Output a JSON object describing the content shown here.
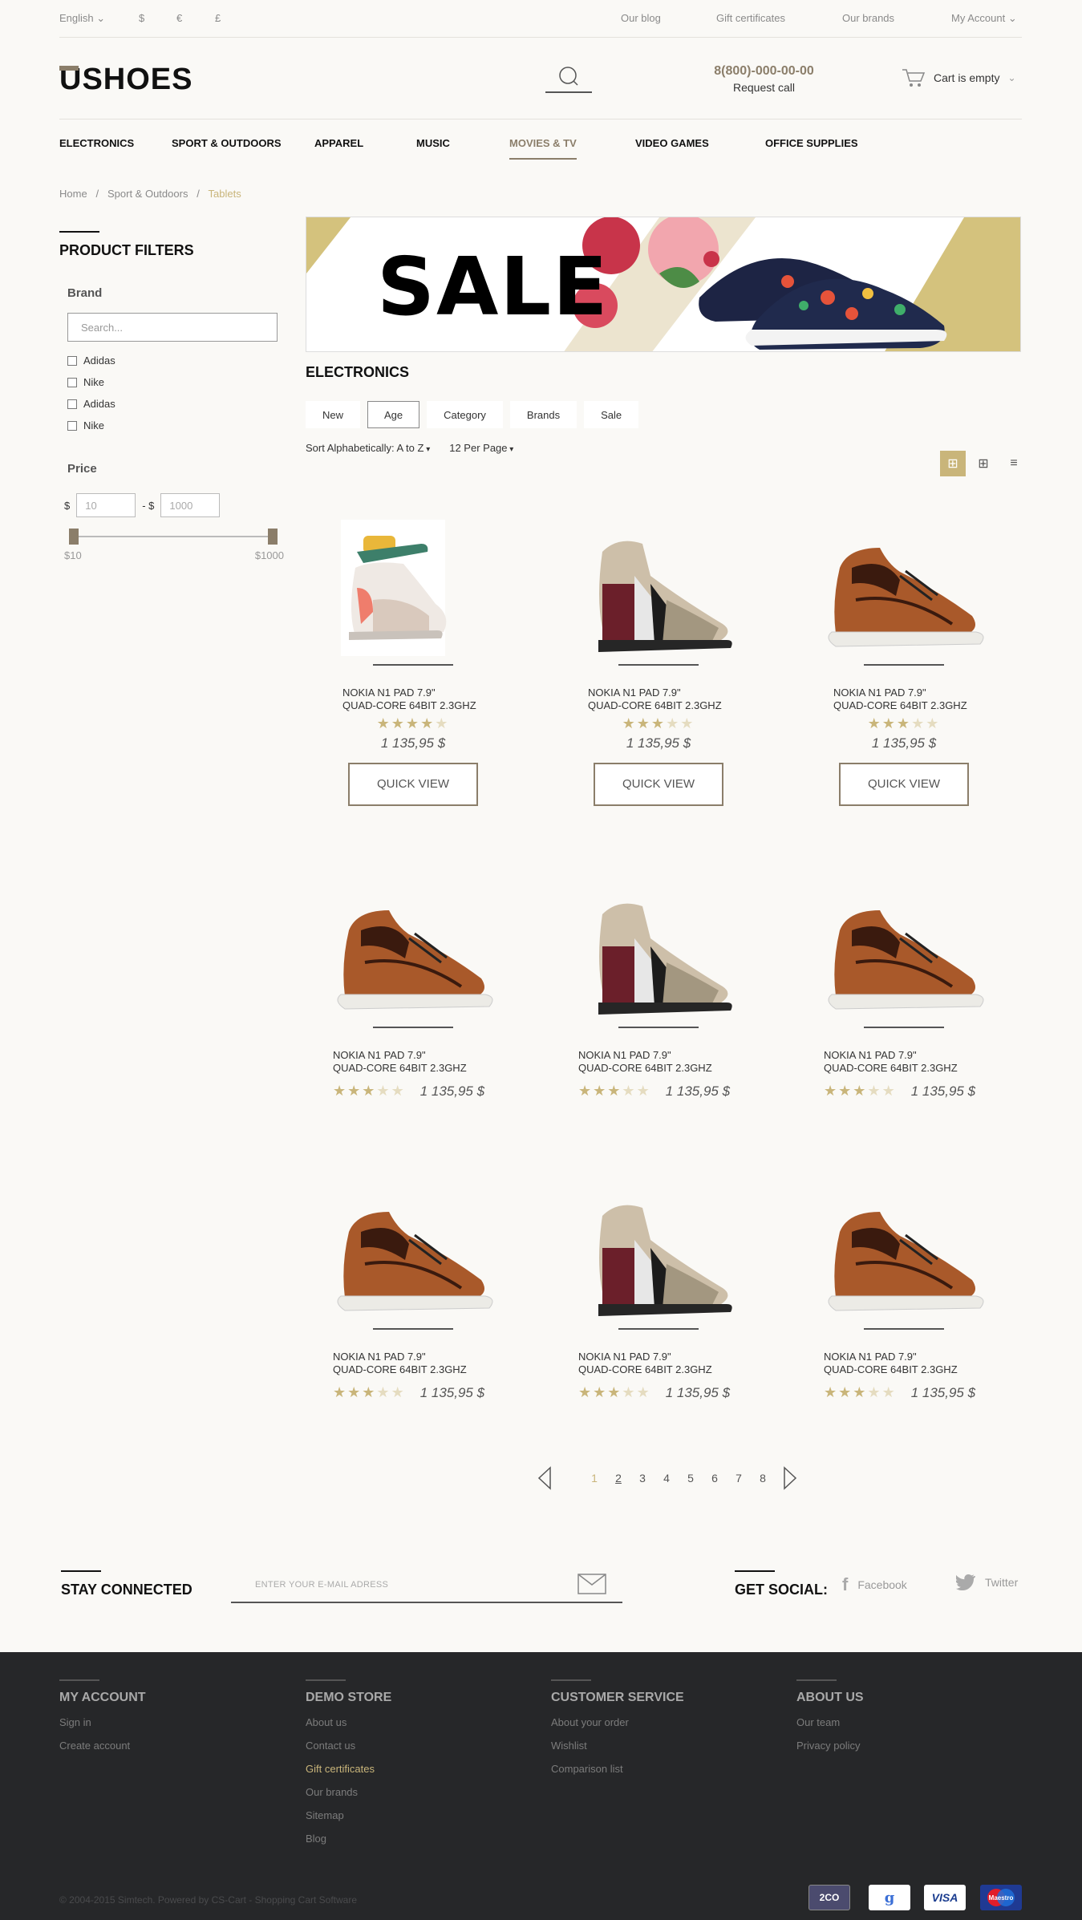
{
  "topbar": {
    "language": "English",
    "currencies": [
      "$",
      "€",
      "£"
    ],
    "links": [
      "Our blog",
      "Gift certificates",
      "Our brands",
      "My Account"
    ]
  },
  "header": {
    "logo": "SHOES",
    "logo_prefix": "U",
    "phone": "8(800)-000-00-00",
    "request_call": "Request call",
    "cart": "Cart is empty"
  },
  "menu": [
    "ELECTRONICS",
    "SPORT & OUTDOORS",
    "APPAREL",
    "MUSIC",
    "MOVIES & TV",
    "VIDEO GAMES",
    "OFFICE SUPPLIES"
  ],
  "breadcrumb": [
    "Home",
    "Sport & Outdoors",
    "Tablets"
  ],
  "filters": {
    "title": "PRODUCT FILTERS",
    "brand_label": "Brand",
    "search_placeholder": "Search...",
    "brands": [
      "Adidas",
      "Nike",
      "Adidas",
      "Nike"
    ],
    "price_label": "Price",
    "min": "10",
    "max": "1000",
    "range_min": "$10",
    "range_max": "$1000"
  },
  "banner": {
    "text": "SALE"
  },
  "listing": {
    "title": "ELECTRONICS",
    "tabs": [
      "New",
      "Age",
      "Category",
      "Brands",
      "Sale"
    ],
    "selected_tab": "Age",
    "sort": "Sort Alphabetically: A to Z",
    "per_page": "12 Per Page"
  },
  "product": {
    "name_line1": "NOKIA N1 PAD 7.9\"",
    "name_line2": "QUAD-CORE 64BIT 2.3GHZ",
    "price": "1 135,95 $",
    "quick_view": "QUICK VIEW"
  },
  "products": [
    {
      "shoe": "white",
      "rating": 4
    },
    {
      "shoe": "maroon",
      "rating": 3
    },
    {
      "shoe": "brown",
      "rating": 3
    },
    {
      "shoe": "brown",
      "rating": 3
    },
    {
      "shoe": "maroon",
      "rating": 3
    },
    {
      "shoe": "brown",
      "rating": 3
    },
    {
      "shoe": "brown",
      "rating": 3
    },
    {
      "shoe": "maroon",
      "rating": 3
    },
    {
      "shoe": "brown",
      "rating": 3
    }
  ],
  "pager": {
    "pages": [
      "1",
      "2",
      "3",
      "4",
      "5",
      "6",
      "7",
      "8"
    ],
    "current": "1"
  },
  "newsletter": {
    "title": "STAY CONNECTED",
    "placeholder": "ENTER YOUR E-MAIL ADRESS"
  },
  "social": {
    "title": "GET SOCIAL:",
    "facebook": "Facebook",
    "twitter": "Twitter"
  },
  "footer": {
    "cols": [
      {
        "title": "MY ACCOUNT",
        "items": [
          "Sign in",
          "Create account"
        ]
      },
      {
        "title": "DEMO STORE",
        "items": [
          "About us",
          "Contact us",
          "Gift certificates",
          "Our brands",
          "Sitemap",
          "Blog"
        ]
      },
      {
        "title": "CUSTOMER SERVICE",
        "items": [
          "About your order",
          "Wishlist",
          "Comparison list"
        ]
      },
      {
        "title": "ABOUT US",
        "items": [
          "Our team",
          "Privacy policy"
        ]
      }
    ],
    "copyright": "© 2004-2015 Simtech.  Powered by CS-Cart - Shopping Cart Software",
    "payments": [
      "2CO",
      "g",
      "VISA",
      "Maestro"
    ]
  },
  "colors": {
    "accent": "#c9b57a",
    "brand": "#8b7e6a",
    "footer_bg": "#262729"
  }
}
